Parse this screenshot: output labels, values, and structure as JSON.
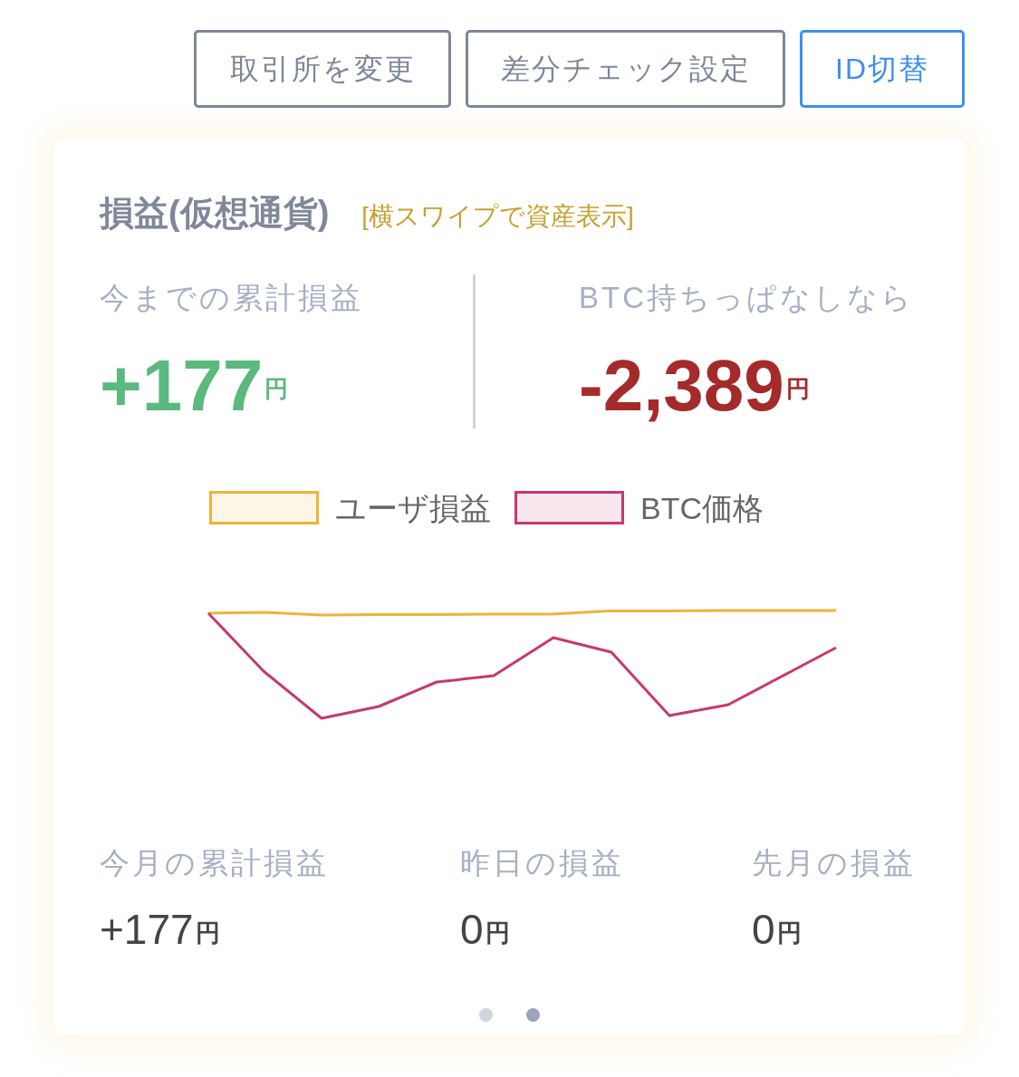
{
  "buttons": [
    {
      "label": "取引所を変更",
      "kind": "outline"
    },
    {
      "label": "差分チェック設定",
      "kind": "outline"
    },
    {
      "label": "ID切替",
      "kind": "primary"
    }
  ],
  "card": {
    "title": "損益(仮想通貨)",
    "hint": "[横スワイプで資産表示]",
    "summary": [
      {
        "label": "今までの累計損益",
        "value": "+177",
        "unit": "円",
        "color": "#5bb97d"
      },
      {
        "label": "BTC持ちっぱなしなら",
        "value": "-2,389",
        "unit": "円",
        "color": "#a52a2a"
      }
    ],
    "chart": {
      "legend": [
        {
          "label": "ユーザ損益",
          "color": "#ecb43a"
        },
        {
          "label": "BTC価格",
          "color": "#c8386e"
        }
      ]
    },
    "stats": [
      {
        "label": "今月の累計損益",
        "value": "+177",
        "unit": "円"
      },
      {
        "label": "昨日の損益",
        "value": "0",
        "unit": "円"
      },
      {
        "label": "先月の損益",
        "value": "0",
        "unit": "円"
      }
    ],
    "pager": [
      {
        "selected": false
      },
      {
        "selected": true
      }
    ]
  }
}
